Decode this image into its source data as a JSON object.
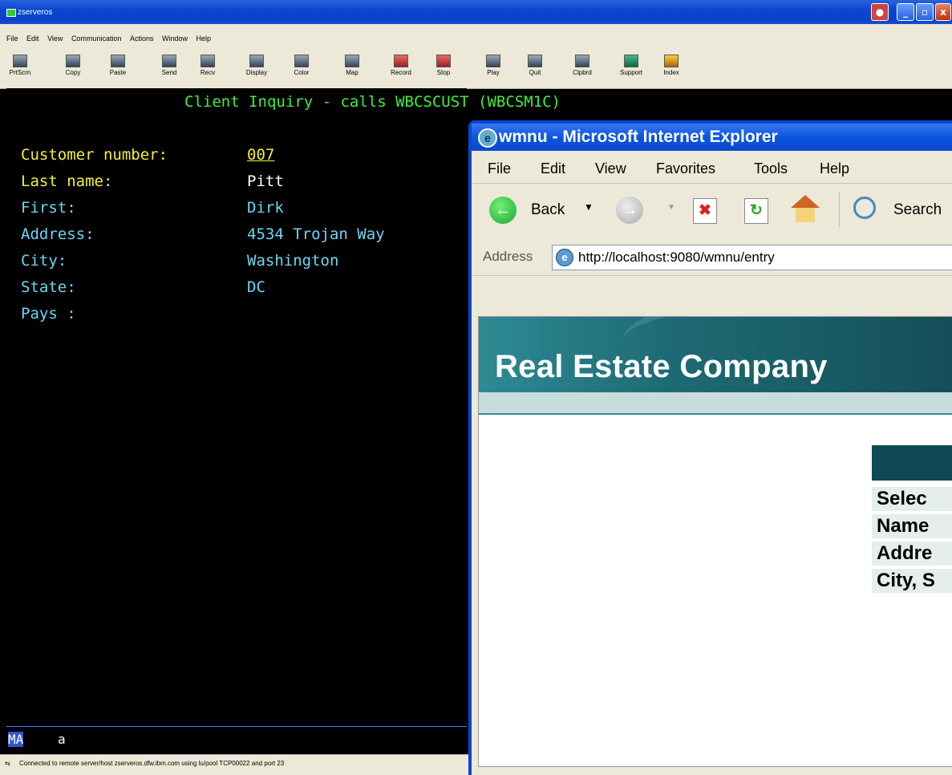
{
  "emulator": {
    "title": "zserveros",
    "menu": [
      "File",
      "Edit",
      "View",
      "Communication",
      "Actions",
      "Window",
      "Help"
    ],
    "toolbar": [
      "PrtScrn",
      "Copy",
      "Paste",
      "Send",
      "Recv",
      "Display",
      "Color",
      "Map",
      "Record",
      "Stop",
      "Play",
      "Quit",
      "Clpbrd",
      "Support",
      "Index"
    ],
    "screen": {
      "heading": "Client Inquiry - calls WBCSCUST (WBCSM1C)",
      "fields": [
        {
          "label": "Customer number:",
          "value": "007"
        },
        {
          "label": "Last name:",
          "value": "Pitt"
        },
        {
          "label": "First:",
          "value": "Dirk"
        },
        {
          "label": "Address:",
          "value": "4534 Trojan Way"
        },
        {
          "label": "City:",
          "value": "Washington"
        },
        {
          "label": "State:",
          "value": "DC"
        },
        {
          "label": "Pays :",
          "value": ""
        }
      ]
    },
    "oia": {
      "mode": "MA",
      "indicator": "a"
    },
    "status": "Connected to remote server/host zserveros.dfw.ibm.com using lu/pool TCP00022 and port 23"
  },
  "browser": {
    "title": "wmnu - Microsoft Internet Explorer",
    "menu": [
      "File",
      "Edit",
      "View",
      "Favorites",
      "Tools",
      "Help"
    ],
    "toolbar": {
      "back": "Back",
      "search": "Search"
    },
    "address_label": "Address",
    "url": "http://localhost:9080/wmnu/entry",
    "page": {
      "banner_title": "Real Estate Company",
      "rows": [
        "Selec",
        "Name",
        "Addre",
        "City, S"
      ]
    }
  }
}
